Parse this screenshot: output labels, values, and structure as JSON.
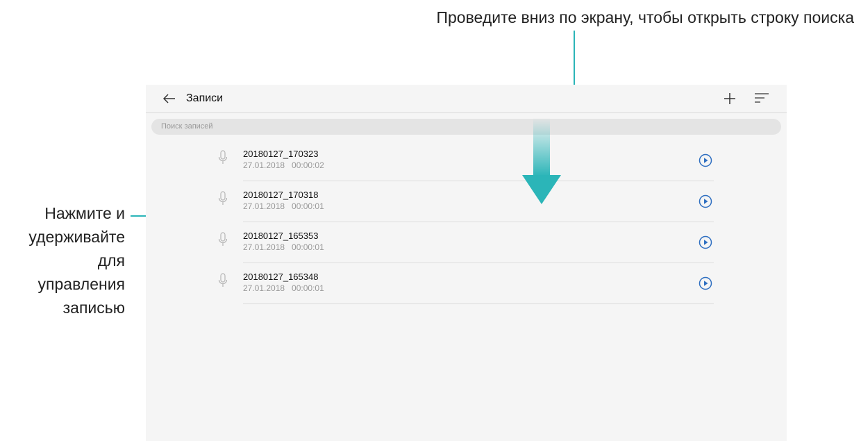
{
  "callouts": {
    "top": "Проведите вниз по экрану, чтобы открыть строку поиска",
    "left": [
      "Нажмите и",
      "удерживайте",
      "для",
      "управления",
      "записью"
    ]
  },
  "header": {
    "back_icon": "arrow-left-icon",
    "title": "Записи",
    "add_icon": "plus-icon",
    "sort_icon": "sort-icon"
  },
  "search": {
    "placeholder": "Поиск записей"
  },
  "records": [
    {
      "name": "20180127_170323",
      "meta": "27.01.2018   00:00:02"
    },
    {
      "name": "20180127_170318",
      "meta": "27.01.2018   00:00:01"
    },
    {
      "name": "20180127_165353",
      "meta": "27.01.2018   00:00:01"
    },
    {
      "name": "20180127_165348",
      "meta": "27.01.2018   00:00:01"
    }
  ],
  "colors": {
    "accent": "#2bb5b8",
    "play": "#2f6fc1",
    "background": "#f5f5f5"
  }
}
